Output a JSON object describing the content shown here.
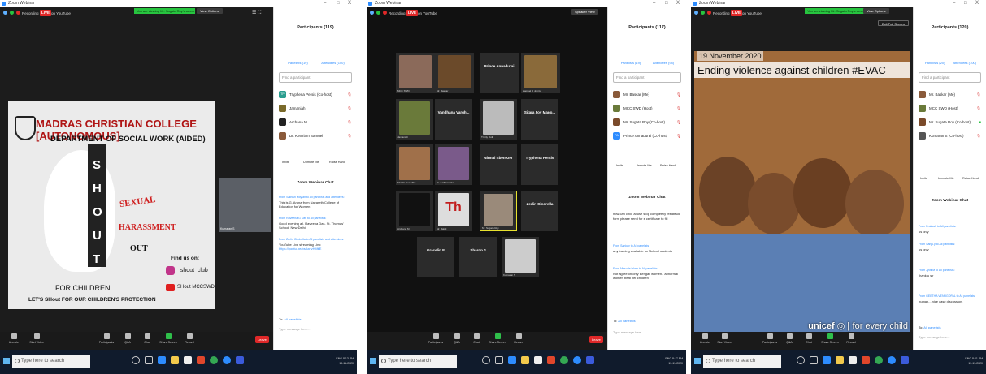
{
  "common": {
    "app_title": "Zoom Webinar",
    "recording": "Recording",
    "live": "LIVE",
    "on_youtube": "on YouTube",
    "minimize": "–",
    "maximize": "□",
    "close": "X",
    "search_placeholder": "Type here to search",
    "controls": {
      "unmute": "Unmute",
      "start_video": "Start Video",
      "participants": "Participants",
      "qa": "Q&A",
      "chat": "Chat",
      "share_screen": "Share Screen",
      "record": "Record",
      "leave": "Leave"
    },
    "panel": {
      "panelists_tab": "Panelists",
      "attendees_tab": "Attendees",
      "find_participant": "Find a participant",
      "invite": "Invite",
      "unmute_me": "Unmute Me",
      "raise_hand": "Raise Hand",
      "chat_title": "Zoom Webinar Chat",
      "to_label": "To:",
      "to_value": "All panelists",
      "type_message": "Type message here..."
    },
    "colors": {
      "zoom_blue": "#2d8cff",
      "live_red": "#e02828",
      "share_green": "#27c43f",
      "taskbar": "#101b2c"
    }
  },
  "shot1": {
    "participants_title": "Participants (119)",
    "panelists_count": "Panelists (19)",
    "attendees_count": "Attendees (100)",
    "participants": [
      {
        "initials": "TP",
        "name": "Tryphena Persis (Co-host)",
        "color": "#2a9d8f"
      },
      {
        "initials": "",
        "name": "Jamaniah",
        "color": "#7a6a2a"
      },
      {
        "initials": "",
        "name": "Archana M",
        "color": "#222222"
      },
      {
        "initials": "",
        "name": "Dr. K Miriam Samuel",
        "color": "#8a5a3a"
      }
    ],
    "slide": {
      "college": "MADRAS CHRISTIAN COLLEGE [AUTONOMOUS]",
      "department": "DEPARTMENT OF SOCIAL WORK (AIDED)",
      "shout_letters": [
        "S",
        "H",
        "O",
        "U",
        "T"
      ],
      "sexual": "SEXUAL",
      "harassment": "HARASSMENT",
      "out": "OUT",
      "for_children": "FOR CHILDREN",
      "tagline": "LET'S SHout FOR OUR CHILDREN'S PROTECTION",
      "find_us": "Find us on:",
      "instagram": "_shout_club_",
      "youtube": "SHout MCCSWD"
    },
    "camera_label": "Kumaran S",
    "chat": [
      {
        "from": "From Sathish Moylan to All panelists and attendees:",
        "text": "This is G. Aruna from Nazareth College of Education for Women"
      },
      {
        "from": "From Raveena G Das to All panelists:",
        "text": "Good evening all. Raveena Das. St. Thomas' School, New Delhi"
      },
      {
        "from": "From Zerlin Cindrella to All panelists and attendees:",
        "text": "YouTube Live streaming Link:",
        "link": "https://youtu.be/bsAxnvH4fkE"
      }
    ],
    "participants_count": "119",
    "tray_time": "8:13 PM",
    "tray_date": "19-11-2020",
    "tray_lang": "ENG"
  },
  "shot2": {
    "participants_title": "Participants (117)",
    "panelists_count": "Panelists (19)",
    "attendees_count": "Attendees (98)",
    "speaker_view": "Speaker View",
    "participants": [
      {
        "initials": "",
        "name": "Mr. Baskar (Me)",
        "color": "#8a5a3a"
      },
      {
        "initials": "",
        "name": "MCC SWD (Host)",
        "color": "#6a7a3a"
      },
      {
        "initials": "",
        "name": "Mr. Sugata Roy (Co-host)",
        "color": "#7a4a2a"
      },
      {
        "initials": "PA",
        "name": "Prince Annadurai (Co-host)",
        "color": "#2d8cff"
      }
    ],
    "tiles": [
      {
        "name": "",
        "label": "MCC SWD",
        "photo": "#8b6a5a"
      },
      {
        "name": "",
        "label": "Mr. Baskar",
        "photo": "#6b4a2a"
      },
      {
        "name": "Prince Annadurai",
        "label": "",
        "photo": ""
      },
      {
        "name": "",
        "label": "Samuel D Jenny",
        "photo": "#8a6a3a"
      },
      {
        "name": "",
        "label": "Jamaniah",
        "photo": "#6a7a3a"
      },
      {
        "name": "Vandhana Vargh...",
        "label": "",
        "photo": ""
      },
      {
        "name": "",
        "label": "Trinity Ruth",
        "photo": "#bbbbbb"
      },
      {
        "name": "Sitara Joy Mano...",
        "label": "",
        "photo": ""
      },
      {
        "name": "",
        "label": "Sharlin Sara Tho...",
        "photo": "#a0704a"
      },
      {
        "name": "",
        "label": "Dr. K Miriam Sa...",
        "photo": "#7a5a8a"
      },
      {
        "name": "Nirmal Ebenezer",
        "label": "",
        "photo": ""
      },
      {
        "name": "Tryphena Persis",
        "label": "",
        "photo": ""
      },
      {
        "name": "",
        "label": "Archana M",
        "photo": "#111111"
      },
      {
        "name": "Th",
        "label": "Mr. Balaji",
        "photo": "#dddddd"
      },
      {
        "name": "",
        "label": "Mr. Sugata Roy",
        "photo": "#9a8a7a"
      },
      {
        "name": "Zerlin Cindrella",
        "label": "",
        "photo": ""
      },
      {
        "name": "Gracelin E",
        "label": "",
        "photo": ""
      },
      {
        "name": "Sharon J",
        "label": "",
        "photo": ""
      },
      {
        "name": "",
        "label": "Kumaran S",
        "photo": "#cccccc"
      }
    ],
    "chat": [
      {
        "from": "",
        "text": "how can child abuse stop completely feedback form please send for e certificate to fill"
      },
      {
        "from": "From Sanju.y to All panelists:",
        "text": "any training available for School students"
      },
      {
        "from": "From Masuda Islam to All panelists:",
        "text": "Not agree on only Bengali women.. abnormal women beat her children"
      }
    ],
    "participants_count": "117",
    "tray_time": "8:17 PM",
    "tray_date": "19-11-2020",
    "tray_lang": "ENG"
  },
  "shot3": {
    "participants_title": "Participants (120)",
    "panelists_count": "Panelists (20)",
    "attendees_count": "Attendees (100)",
    "viewing_banner": "You are viewing Mr. Sugata Roy's screen",
    "view_options": "View Options",
    "exit_fullscreen": "Exit Full Screen",
    "participants": [
      {
        "initials": "",
        "name": "Mr. Baskar (Me)",
        "color": "#8a5a3a"
      },
      {
        "initials": "",
        "name": "MCC SWD (Host)",
        "color": "#6a7a3a"
      },
      {
        "initials": "",
        "name": "Mr. Sugata Roy (Co-host)",
        "color": "#7a4a2a"
      },
      {
        "initials": "",
        "name": "Kumaran S (Co-host)",
        "color": "#555555"
      }
    ],
    "slide": {
      "date": "19 November 2020",
      "title": "Ending violence against children #EVAC",
      "unicef": "unicef",
      "tagline": "for every child"
    },
    "chat": [
      {
        "from": "From Prakash to All panelists:",
        "text": "us only"
      },
      {
        "from": "From Sanju.y to All panelists:",
        "text": "us only"
      },
      {
        "from": "From Jyoti M to All panelists:",
        "text": "thank u sir"
      },
      {
        "from": "From GEETHA VENUGOPAL to All panelists:",
        "text": "human....nice case discussion."
      }
    ],
    "participants_count": "120",
    "tray_time": "8:21 PM",
    "tray_date": "19-11-2020",
    "tray_lang": "ENG"
  }
}
